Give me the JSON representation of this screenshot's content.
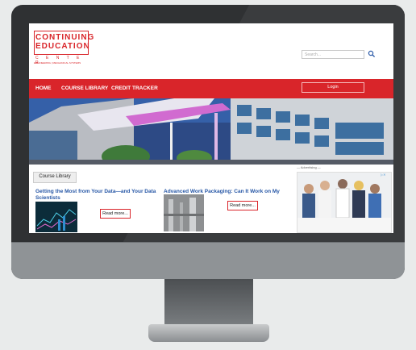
{
  "logo": {
    "line1": "CONTINUING",
    "line2": "EDUCATION",
    "line3": "C E N T E R",
    "line4": "ENGINEERING | MECHANICAL SYSTEMS"
  },
  "search": {
    "placeholder": "Search..."
  },
  "nav": {
    "items": [
      "HOME",
      "COURSE LIBRARY",
      "CREDIT TRACKER"
    ],
    "login_label": "Login"
  },
  "tab": {
    "label": "Course Library"
  },
  "courses": [
    {
      "title": "Getting the Most from Your Data—and Your Data Scientists",
      "button": "Read more..."
    },
    {
      "title": "Advanced Work Packaging: Can It Work on My Job?",
      "button": "Read more..."
    }
  ],
  "ad": {
    "label": "— Advertising —"
  },
  "colors": {
    "brand_red": "#d9252a",
    "link_blue": "#2757a6"
  }
}
